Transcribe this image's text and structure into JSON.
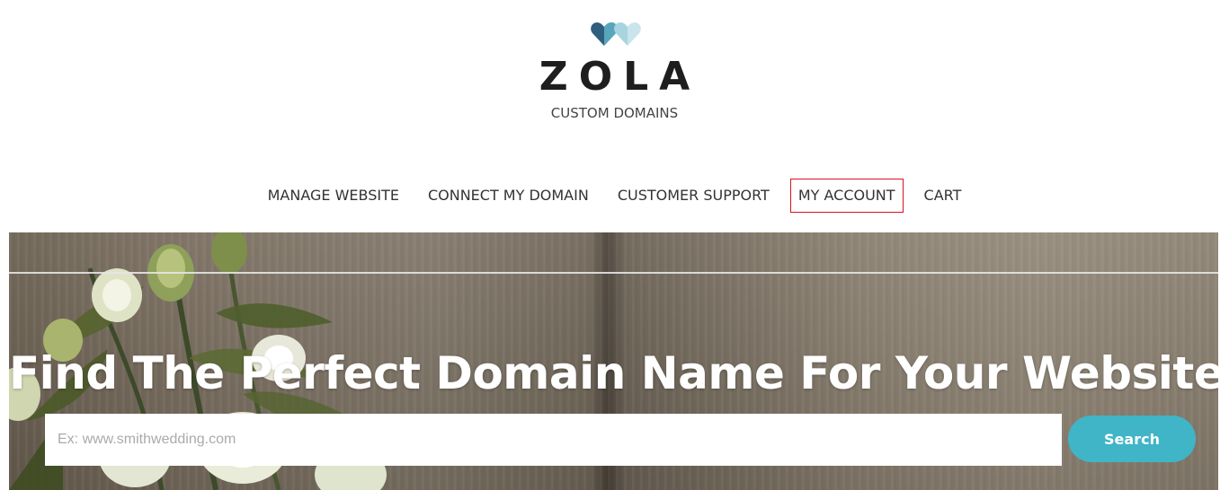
{
  "brand": {
    "name": "ZOLA",
    "subtitle": "CUSTOM DOMAINS",
    "colors": [
      "#2f5f7e",
      "#5fb3c6",
      "#c7e3ea"
    ]
  },
  "nav": {
    "items": [
      {
        "label": "MANAGE WEBSITE",
        "active": false
      },
      {
        "label": "CONNECT MY DOMAIN",
        "active": false
      },
      {
        "label": "CUSTOMER SUPPORT",
        "active": false
      },
      {
        "label": "MY ACCOUNT",
        "active": true
      },
      {
        "label": "CART",
        "active": false
      }
    ]
  },
  "hero": {
    "title": "Find The Perfect Domain Name For Your Website",
    "search": {
      "placeholder": "Ex: www.smithwedding.com",
      "value": "",
      "button_label": "Search",
      "button_color": "#3fb5c7"
    }
  }
}
